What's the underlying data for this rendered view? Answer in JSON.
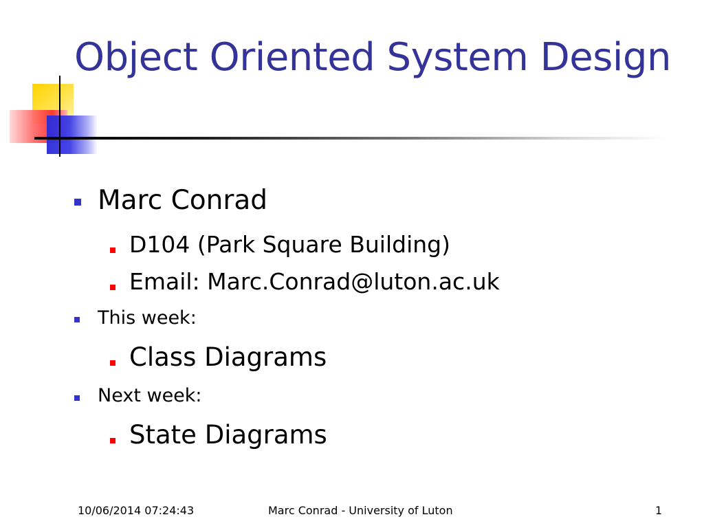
{
  "slide": {
    "title": "Object Oriented System Design",
    "accent_color": "#333399",
    "bullets": [
      {
        "text": "Marc Conrad",
        "level": 1,
        "bullet_color": "#3333cc"
      },
      {
        "text": "D104 (Park Square Building)",
        "level": 2,
        "bullet_color": "#ff0000"
      },
      {
        "text": "Email: Marc.Conrad@luton.ac.uk",
        "level": 2,
        "bullet_color": "#ff0000"
      },
      {
        "text": "This week:",
        "level": 1,
        "bullet_color": "#3333cc"
      },
      {
        "text": "Class Diagrams",
        "level": 2,
        "bullet_color": "#ff0000"
      },
      {
        "text": "Next week:",
        "level": 1,
        "bullet_color": "#3333cc"
      },
      {
        "text": "State Diagrams",
        "level": 2,
        "bullet_color": "#ff0000"
      }
    ]
  },
  "footer": {
    "date": "10/06/2014 07:24:43",
    "center": "Marc Conrad - University of Luton",
    "page_number": "1"
  }
}
